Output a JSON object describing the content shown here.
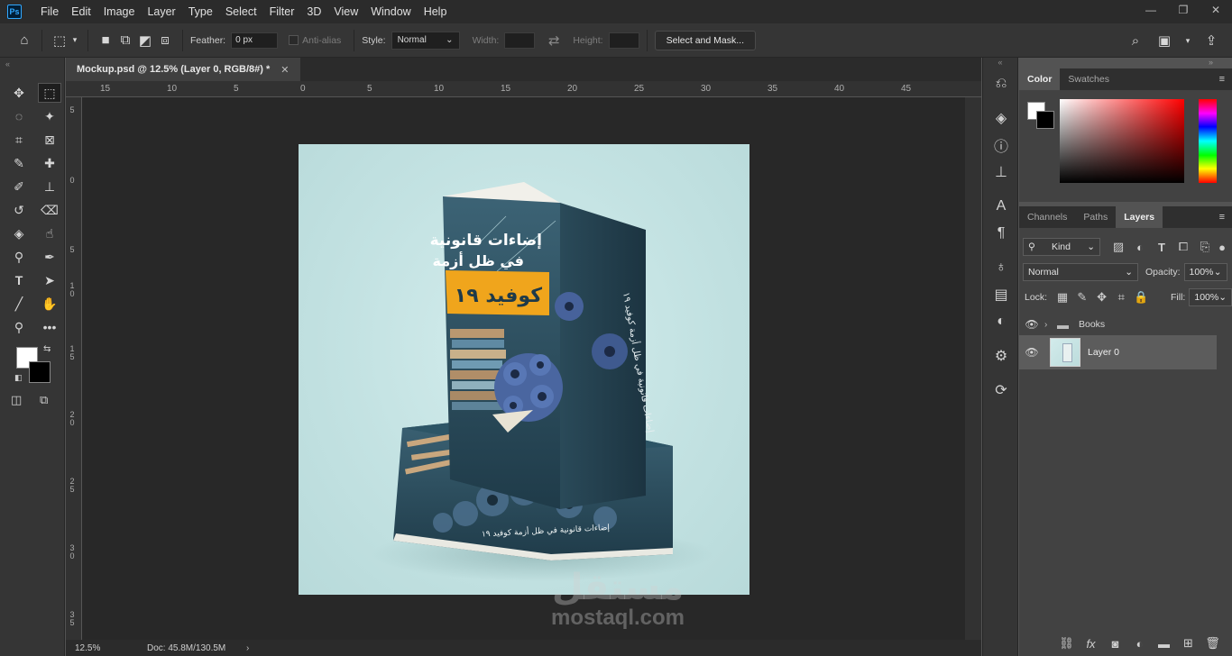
{
  "app": {
    "logo": "Ps"
  },
  "menu": [
    "File",
    "Edit",
    "Image",
    "Layer",
    "Type",
    "Select",
    "Filter",
    "3D",
    "View",
    "Window",
    "Help"
  ],
  "window_controls": {
    "minimize": "—",
    "restore": "❐",
    "close": "✕"
  },
  "options": {
    "feather_label": "Feather:",
    "feather_value": "0 px",
    "antialias_label": "Anti-alias",
    "style_label": "Style:",
    "style_value": "Normal",
    "width_label": "Width:",
    "height_label": "Height:",
    "select_mask_label": "Select and Mask..."
  },
  "document": {
    "tab_title": "Mockup.psd @ 12.5% (Layer 0, RGB/8#) *",
    "zoom": "12.5%",
    "doc_size": "Doc: 45.8M/130.5M",
    "ruler_h": [
      "15",
      "10",
      "5",
      "0",
      "5",
      "10",
      "15",
      "20",
      "25",
      "30",
      "35",
      "40",
      "45"
    ],
    "ruler_v": [
      "5",
      "0",
      "5",
      "1\n0",
      "1\n5",
      "2\n0",
      "2\n5",
      "3\n0",
      "3\n5"
    ]
  },
  "mockup": {
    "title_line1": "إضاءات قانونية",
    "title_line2": "في ظل أزمة",
    "title_banner": "كوفيد ١٩",
    "spine_text": "إضاءات قانونية في ظل أزمة كوفيد ١٩",
    "bottom_book_text": "إضاءات قانونية في ظل أزمة كوفيد ١٩"
  },
  "watermark": {
    "arabic": "مستقل",
    "latin": "mostaql.com"
  },
  "color_panel": {
    "tabs": [
      "Color",
      "Swatches"
    ],
    "active": "Color"
  },
  "layers_panel": {
    "tabs": [
      "Channels",
      "Paths",
      "Layers"
    ],
    "active": "Layers",
    "filter_kind": "Kind",
    "blend_mode": "Normal",
    "opacity_label": "Opacity:",
    "opacity_value": "100%",
    "lock_label": "Lock:",
    "fill_label": "Fill:",
    "fill_value": "100%",
    "layers": [
      {
        "name": "Books",
        "type": "group"
      },
      {
        "name": "Layer 0",
        "type": "pixel",
        "selected": true
      }
    ]
  }
}
